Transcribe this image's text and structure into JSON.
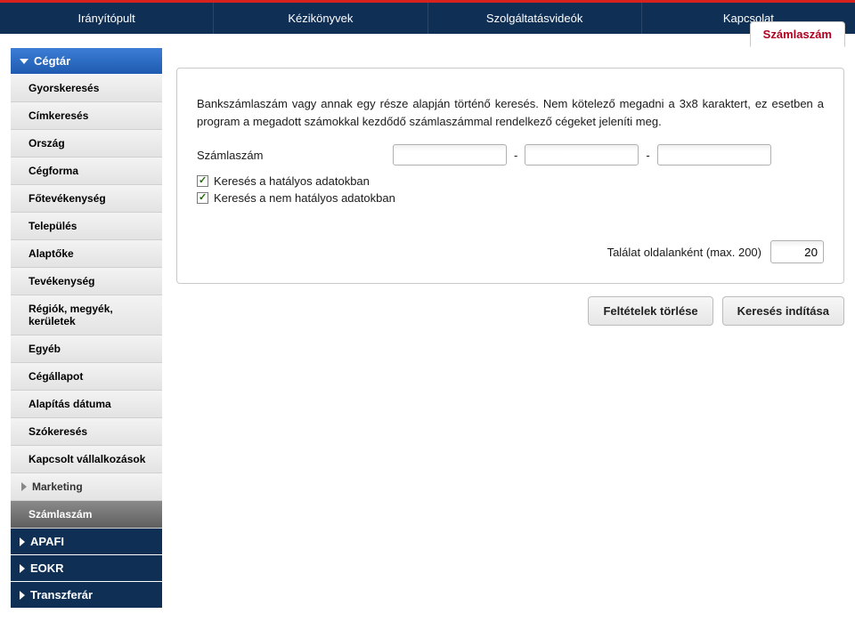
{
  "topnav": [
    {
      "label": "Irányítópult"
    },
    {
      "label": "Kézikönyvek"
    },
    {
      "label": "Szolgáltatásvideók"
    },
    {
      "label": "Kapcsolat"
    }
  ],
  "sidebar": {
    "active_header": "Cégtár",
    "subitems": [
      "Gyorskeresés",
      "Címkeresés",
      "Ország",
      "Cégforma",
      "Főtevékenység",
      "Település",
      "Alaptőke",
      "Tevékenység",
      "Régiók, megyék, kerületek",
      "Egyéb",
      "Cégállapot",
      "Alapítás dátuma",
      "Szókeresés",
      "Kapcsolt vállalkozások"
    ],
    "marketing_label": "Marketing",
    "selected_sub": "Számlaszám",
    "other_headers": [
      "APAFI",
      "EOKR",
      "Transzferár"
    ]
  },
  "main": {
    "tab_label": "Számlaszám",
    "description": "Bankszámlaszám vagy annak egy része alapján történő keresés. Nem kötelező megadni a 3x8 karaktert, ez esetben a program a megadott számokkal kezdődő számlaszámmal rendelkező cégeket jeleníti meg.",
    "field_label": "Számlaszám",
    "segment_separator": "-",
    "segments": [
      "",
      "",
      ""
    ],
    "chk1_label": "Keresés a hatályos adatokban",
    "chk1_checked": true,
    "chk2_label": "Keresés a nem hatályos adatokban",
    "chk2_checked": true,
    "results_label": "Találat oldalanként (max. 200)",
    "results_value": "20",
    "btn_clear": "Feltételek törlése",
    "btn_search": "Keresés indítása"
  }
}
